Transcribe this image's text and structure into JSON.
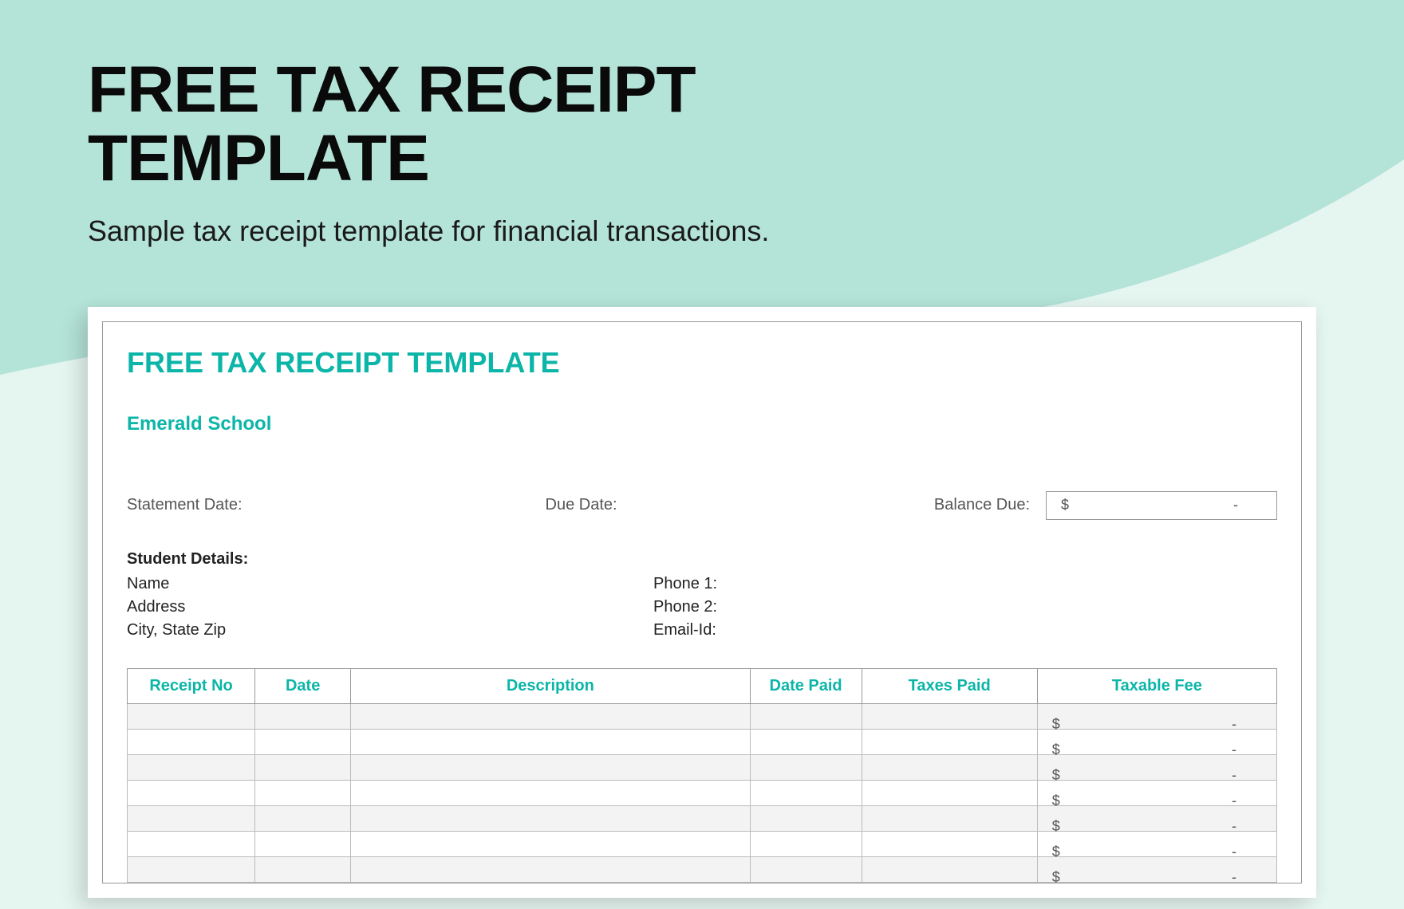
{
  "header": {
    "title_line1": "FREE TAX RECEIPT",
    "title_line2": "TEMPLATE",
    "subtitle": "Sample tax receipt template for financial transactions."
  },
  "document": {
    "title": "FREE TAX RECEIPT TEMPLATE",
    "org_name": "Emerald School",
    "labels": {
      "statement_date": "Statement Date:",
      "due_date": "Due Date:",
      "balance_due": "Balance Due:",
      "student_details": "Student Details:",
      "name": "Name",
      "address": "Address",
      "city_state_zip": "City, State Zip",
      "phone1": "Phone 1:",
      "phone2": "Phone 2:",
      "email": "Email-Id:"
    },
    "balance_box": {
      "currency": "$",
      "value": "-"
    },
    "table": {
      "headers": {
        "receipt_no": "Receipt No",
        "date": "Date",
        "description": "Description",
        "date_paid": "Date Paid",
        "taxes_paid": "Taxes Paid",
        "taxable_fee": "Taxable Fee"
      },
      "rows": [
        {
          "currency": "$",
          "value": "-"
        },
        {
          "currency": "$",
          "value": "-"
        },
        {
          "currency": "$",
          "value": "-"
        },
        {
          "currency": "$",
          "value": "-"
        },
        {
          "currency": "$",
          "value": "-"
        },
        {
          "currency": "$",
          "value": "-"
        },
        {
          "currency": "$",
          "value": "-"
        }
      ]
    }
  },
  "colors": {
    "bg_light": "#e5f5f0",
    "bg_wave": "#b4e3d7",
    "accent": "#0bb5a8"
  }
}
